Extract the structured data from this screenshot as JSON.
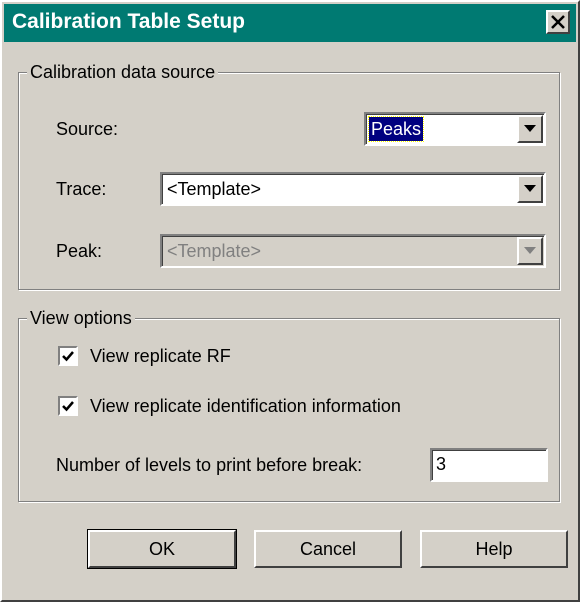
{
  "window": {
    "title": "Calibration Table Setup",
    "close_icon": "close-x-icon"
  },
  "data_source": {
    "legend": "Calibration data source",
    "source_label": "Source:",
    "source_value": "Peaks",
    "trace_label": "Trace:",
    "trace_value": "<Template>",
    "peak_label": "Peak:",
    "peak_value": "<Template>",
    "peak_enabled": false
  },
  "view_options": {
    "legend": "View options",
    "replicate_rf_label": "View replicate RF",
    "replicate_rf_checked": true,
    "replicate_id_label": "View replicate identification information",
    "replicate_id_checked": true,
    "levels_label": "Number of levels to print before break:",
    "levels_value": "3"
  },
  "buttons": {
    "ok": "OK",
    "cancel": "Cancel",
    "help": "Help"
  },
  "colors": {
    "titlebar": "#007a72",
    "face": "#d4d0c8",
    "selection": "#000080"
  }
}
